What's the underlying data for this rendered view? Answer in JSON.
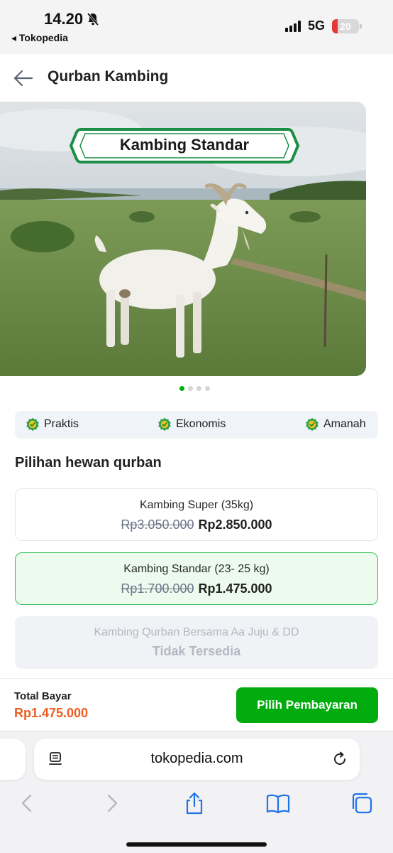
{
  "status_bar": {
    "time": "14.20",
    "back_app": "◂ Tokopedia",
    "network": "5G",
    "battery": "20",
    "battery_level": 0.2
  },
  "header": {
    "title": "Qurban Kambing",
    "back_icon": "arrow-left-icon"
  },
  "banner": {
    "label": "Kambing Standar",
    "dots_total": 4,
    "dots_active": 0
  },
  "features": [
    {
      "label": "Praktis",
      "icon": "check-badge-icon"
    },
    {
      "label": "Ekonomis",
      "icon": "check-badge-icon"
    },
    {
      "label": "Amanah",
      "icon": "check-badge-icon"
    }
  ],
  "section_title": "Pilihan hewan qurban",
  "options": [
    {
      "name": "Kambing Super (35kg)",
      "old_price": "Rp3.050.000",
      "price": "Rp2.850.000",
      "selected": false
    },
    {
      "name": "Kambing Standar (23- 25 kg)",
      "old_price": "Rp1.700.000",
      "price": "Rp1.475.000",
      "selected": true
    },
    {
      "name": "Kambing Qurban Bersama Aa Juju & DD",
      "status": "Tidak Tersedia",
      "disabled": true
    }
  ],
  "checkout": {
    "total_label": "Total Bayar",
    "total_value": "Rp1.475.000",
    "button_label": "Pilih Pembayaran"
  },
  "browser": {
    "url": "tokopedia.com",
    "toolbar_icons": [
      "back-icon",
      "forward-icon",
      "share-icon",
      "bookmarks-icon",
      "tabs-icon"
    ]
  },
  "colors": {
    "primary_green": "#03ac0e",
    "price_orange": "#ee5d21",
    "selected_border": "#38c25a",
    "selected_bg": "#ecfbee"
  }
}
